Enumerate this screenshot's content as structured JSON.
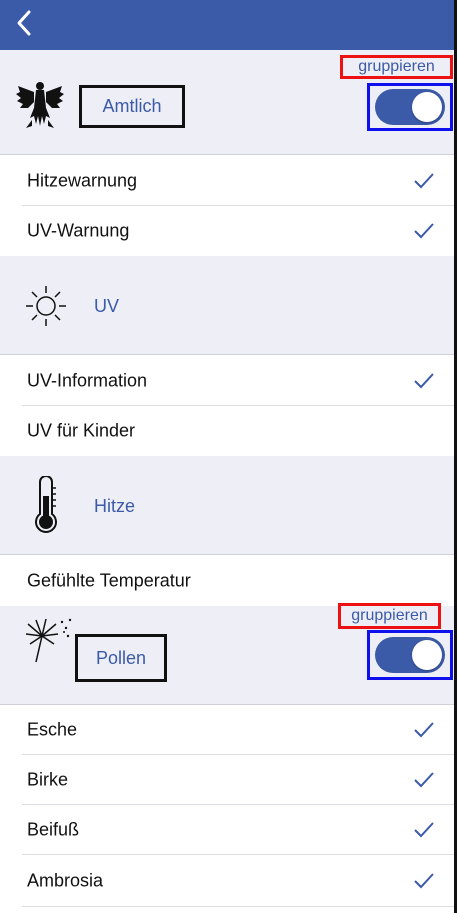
{
  "header": {
    "back_icon": "chevron-left-icon"
  },
  "colors": {
    "brand": "#3b5aa8",
    "section_bg": "#eeeff6",
    "check": "#3b5aa8"
  },
  "sections": {
    "amtlich": {
      "title": "Amtlich",
      "icon": "federal-eagle-icon",
      "group_label": "gruppieren",
      "toggle_on": true,
      "items": [
        {
          "label": "Hitzewarnung",
          "checked": true
        },
        {
          "label": "UV-Warnung",
          "checked": true
        }
      ]
    },
    "uv": {
      "title": "UV",
      "icon": "sun-icon",
      "items": [
        {
          "label": "UV-Information",
          "checked": true
        },
        {
          "label": "UV für Kinder",
          "checked": false
        }
      ]
    },
    "hitze": {
      "title": "Hitze",
      "icon": "thermometer-icon",
      "items": [
        {
          "label": "Gefühlte Temperatur",
          "checked": false
        }
      ]
    },
    "pollen": {
      "title": "Pollen",
      "icon": "dandelion-icon",
      "group_label": "gruppieren",
      "toggle_on": true,
      "items": [
        {
          "label": "Esche",
          "checked": true
        },
        {
          "label": "Birke",
          "checked": true
        },
        {
          "label": "Beifuß",
          "checked": true
        },
        {
          "label": "Ambrosia",
          "checked": true
        }
      ]
    }
  }
}
